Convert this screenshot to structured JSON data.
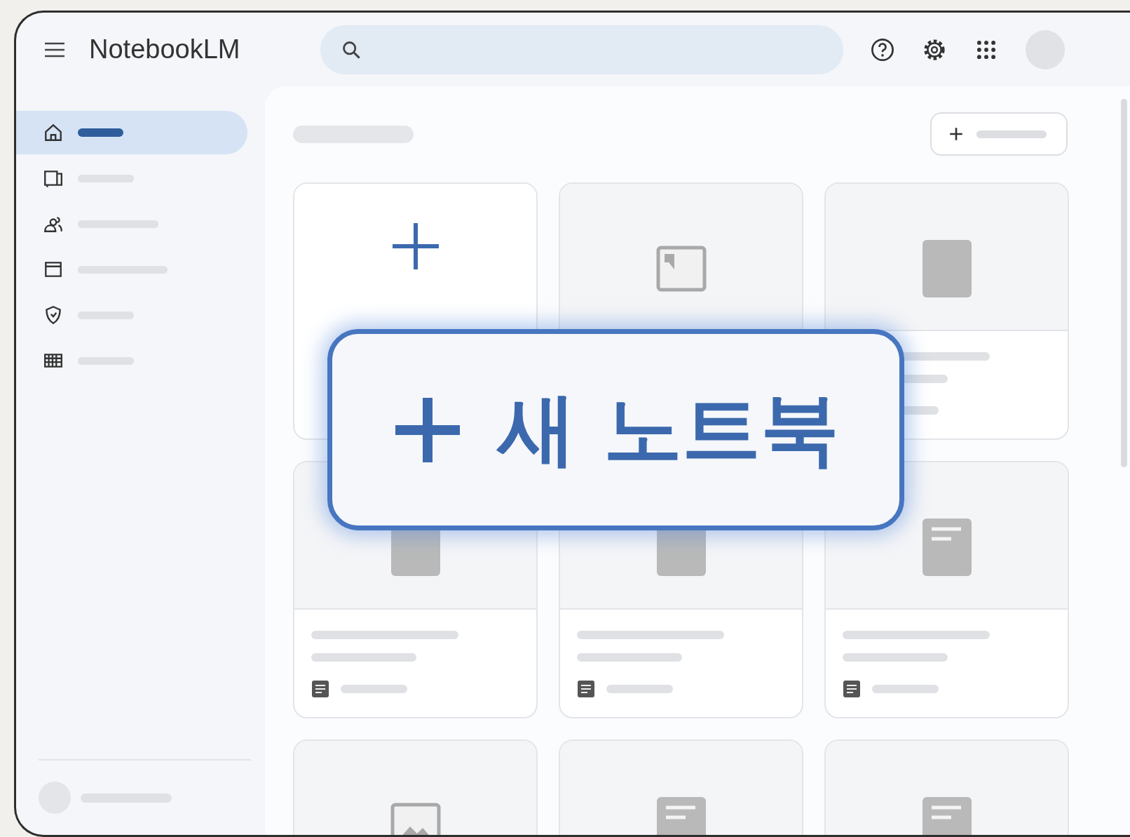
{
  "header": {
    "title": "NotebookLM"
  },
  "sidebar": {
    "items": [
      {
        "kind": "home",
        "selected": true
      },
      {
        "kind": "book",
        "selected": false
      },
      {
        "kind": "people",
        "selected": false
      },
      {
        "kind": "window",
        "selected": false
      },
      {
        "kind": "shield",
        "selected": false
      },
      {
        "kind": "grid",
        "selected": false
      }
    ]
  },
  "cards": [
    {
      "kind": "new"
    },
    {
      "kind": "frame"
    },
    {
      "kind": "block"
    },
    {
      "kind": "block"
    },
    {
      "kind": "block"
    },
    {
      "kind": "note"
    },
    {
      "kind": "picture"
    },
    {
      "kind": "note"
    },
    {
      "kind": "note"
    }
  ],
  "callout": {
    "label": "새 노트북"
  }
}
